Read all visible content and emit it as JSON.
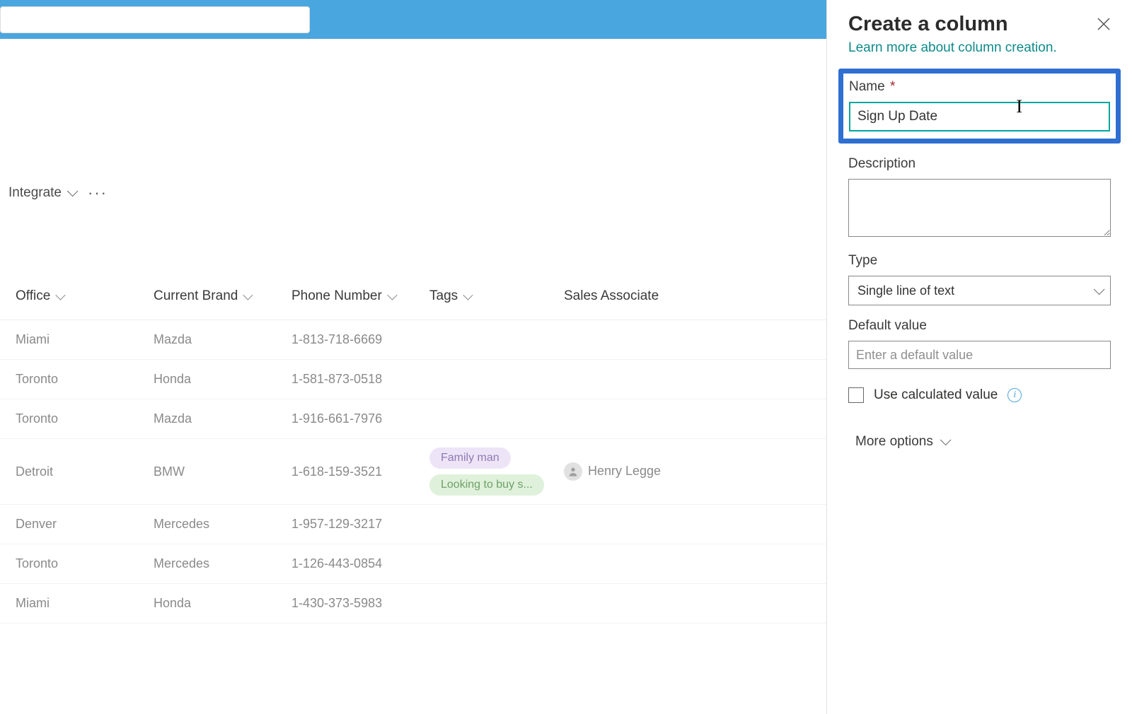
{
  "header": {
    "search_value": ""
  },
  "toolbar": {
    "integrate_label": "Integrate",
    "more_label": "···"
  },
  "table": {
    "columns": {
      "office": "Office",
      "brand": "Current Brand",
      "phone": "Phone Number",
      "tags": "Tags",
      "sales": "Sales Associate"
    },
    "rows": [
      {
        "office": "Miami",
        "brand": "Mazda",
        "phone": "1-813-718-6669",
        "tags": [],
        "sales": ""
      },
      {
        "office": "Toronto",
        "brand": "Honda",
        "phone": "1-581-873-0518",
        "tags": [],
        "sales": ""
      },
      {
        "office": "Toronto",
        "brand": "Mazda",
        "phone": "1-916-661-7976",
        "tags": [],
        "sales": ""
      },
      {
        "office": "Detroit",
        "brand": "BMW",
        "phone": "1-618-159-3521",
        "tags": [
          "Family man",
          "Looking to buy s..."
        ],
        "sales": "Henry Legge"
      },
      {
        "office": "Denver",
        "brand": "Mercedes",
        "phone": "1-957-129-3217",
        "tags": [],
        "sales": ""
      },
      {
        "office": "Toronto",
        "brand": "Mercedes",
        "phone": "1-126-443-0854",
        "tags": [],
        "sales": ""
      },
      {
        "office": "Miami",
        "brand": "Honda",
        "phone": "1-430-373-5983",
        "tags": [],
        "sales": ""
      }
    ]
  },
  "panel": {
    "title": "Create a column",
    "learn_link": "Learn more about column creation.",
    "name_label": "Name",
    "name_value": "Sign Up Date",
    "description_label": "Description",
    "description_value": "",
    "type_label": "Type",
    "type_value": "Single line of text",
    "default_label": "Default value",
    "default_placeholder": "Enter a default value",
    "default_value": "",
    "calc_label": "Use calculated value",
    "more_options_label": "More options"
  },
  "colors": {
    "accent_blue": "#2f6fd1",
    "teal": "#00a7a0",
    "header_blue": "#4aa6df"
  }
}
